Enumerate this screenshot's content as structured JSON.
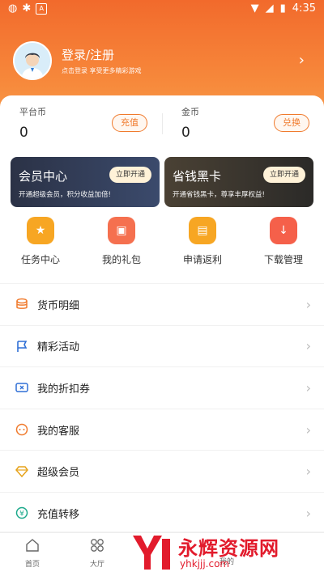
{
  "status_bar": {
    "time": "4:35"
  },
  "profile": {
    "title": "登录/注册",
    "subtitle": "点击登录 享受更多精彩游戏"
  },
  "wallet": {
    "platform": {
      "label": "平台币",
      "value": "0",
      "action": "充值"
    },
    "gold": {
      "label": "金币",
      "value": "0",
      "action": "兑换"
    }
  },
  "promos": [
    {
      "title": "会员中心",
      "subtitle": "开通超级会员，积分收益加倍!",
      "button": "立即开通"
    },
    {
      "title": "省钱黑卡",
      "subtitle": "开通省钱黑卡，尊享丰厚权益!",
      "button": "立即开通"
    }
  ],
  "quick_actions": [
    {
      "label": "任务中心",
      "icon": "task-icon",
      "color": "#f7a623"
    },
    {
      "label": "我的礼包",
      "icon": "gift-icon",
      "color": "#f5704f"
    },
    {
      "label": "申请返利",
      "icon": "rebate-icon",
      "color": "#f7a623"
    },
    {
      "label": "下载管理",
      "icon": "download-icon",
      "color": "#f5604a"
    }
  ],
  "menu": [
    {
      "label": "货币明细",
      "icon": "coins-icon"
    },
    {
      "label": "精彩活动",
      "icon": "flag-icon"
    },
    {
      "label": "我的折扣券",
      "icon": "ticket-icon"
    },
    {
      "label": "我的客服",
      "icon": "chat-icon"
    },
    {
      "label": "超级会员",
      "icon": "diamond-icon"
    },
    {
      "label": "充值转移",
      "icon": "yuan-icon"
    }
  ],
  "tabs": [
    {
      "label": "首页",
      "icon": "home-icon"
    },
    {
      "label": "大厅",
      "icon": "grid-icon"
    },
    {
      "label": "",
      "icon": "app-icon"
    },
    {
      "label": "我的",
      "icon": "user-icon"
    },
    {
      "label": "",
      "icon": "more-icon"
    }
  ],
  "watermark": {
    "title": "永辉资源网",
    "url": "yhkjjj.com"
  },
  "colors": {
    "accent": "#f07a2c",
    "header": "#f26a2c"
  }
}
